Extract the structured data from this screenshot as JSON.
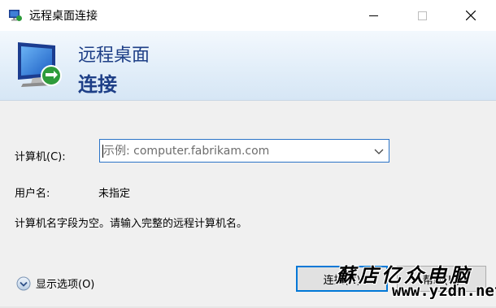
{
  "window": {
    "title": "远程桌面连接",
    "controls": {
      "minimize_icon": "minimize-icon",
      "maximize_icon": "maximize-icon",
      "close_icon": "close-icon"
    }
  },
  "banner": {
    "line1": "远程桌面",
    "line2": "连接",
    "icon": "remote-desktop-icon"
  },
  "form": {
    "computer_label": "计算机(C):",
    "computer_placeholder": "示例: computer.fabrikam.com",
    "computer_value": "",
    "username_label": "用户名:",
    "username_value": "未指定",
    "message": "计算机名字段为空。请输入完整的远程计算机名。"
  },
  "footer": {
    "show_options_label": "显示选项(O)",
    "connect_label": "连接(N)",
    "help_label": "帮助(H)"
  },
  "watermark": {
    "text_cn": "蘇店亿众电脑",
    "url": "www.yzdn.net"
  },
  "colors": {
    "accent": "#0078d7",
    "banner_text": "#1e3f87"
  }
}
